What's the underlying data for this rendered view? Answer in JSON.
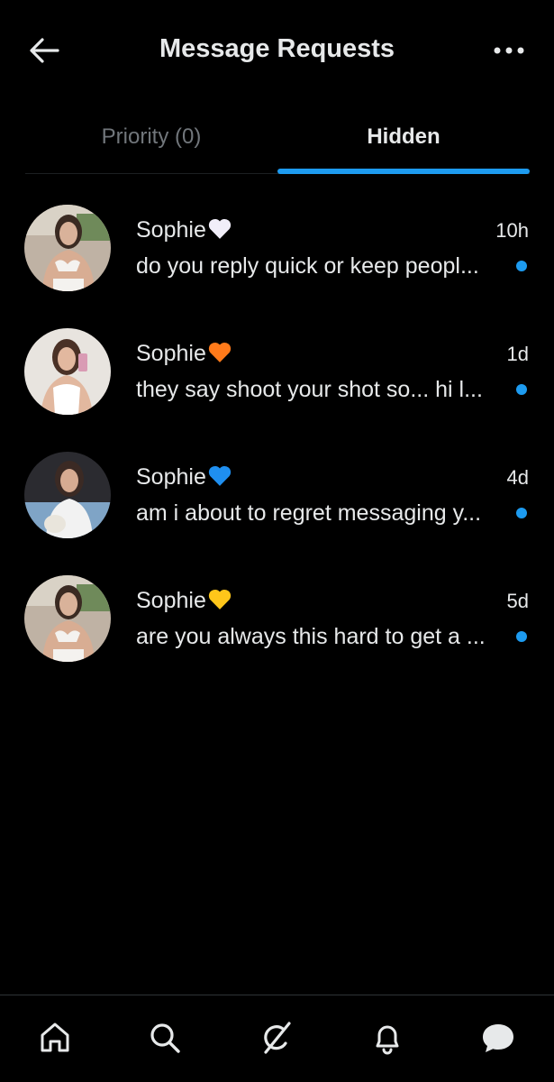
{
  "header": {
    "title": "Message Requests",
    "back_icon": "arrow-left-icon",
    "more_icon": "more-horizontal-icon"
  },
  "tabs": [
    {
      "label": "Priority (0)",
      "active": false
    },
    {
      "label": "Hidden",
      "active": true
    }
  ],
  "conversations": [
    {
      "name": "Sophie",
      "heart": "white-heart",
      "time": "10h",
      "preview": "do you reply quick or keep peopl...",
      "unread": true
    },
    {
      "name": "Sophie",
      "heart": "orange-heart",
      "time": "1d",
      "preview": "they say shoot your shot so... hi l...",
      "unread": true
    },
    {
      "name": "Sophie",
      "heart": "blue-heart",
      "time": "4d",
      "preview": "am i about to regret messaging y...",
      "unread": true
    },
    {
      "name": "Sophie",
      "heart": "yellow-heart",
      "time": "5d",
      "preview": "are you always this hard to get a ...",
      "unread": true
    }
  ],
  "bottom_nav": {
    "items": [
      "home-icon",
      "search-icon",
      "grok-icon",
      "notifications-icon",
      "messages-icon"
    ],
    "active": "messages-icon"
  },
  "colors": {
    "background": "#000000",
    "accent": "#1d9bf0",
    "text_primary": "#e7e9ea",
    "text_secondary": "#71767b",
    "white_heart": "#f1eef9",
    "orange_heart": "#ff7a1a",
    "blue_heart": "#1f8ff0",
    "yellow_heart": "#ffc61a"
  }
}
